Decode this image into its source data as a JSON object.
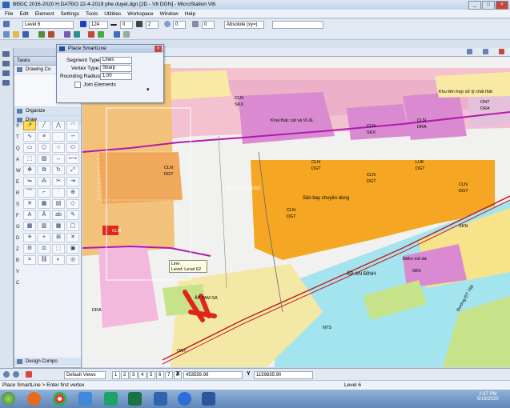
{
  "window": {
    "title": "BĐDC 2016-2020 H.DATĐO 22-4-2019 phe duyet.dgn [2D - V8 DGN] - MicroStation V8i"
  },
  "menu": [
    "File",
    "Edit",
    "Element",
    "Settings",
    "Tools",
    "Utilities",
    "Workspace",
    "Window",
    "Help"
  ],
  "attributes_toolbar": {
    "level": "Level 6",
    "color": "124",
    "weight": "2",
    "style": "0",
    "transparency": "0",
    "priority": "0",
    "class": "Absolute (xy=)"
  },
  "tasks_panel": {
    "title": "Tasks",
    "items": [
      "Drawing Co"
    ],
    "organize": "Organize",
    "draw": "Draw",
    "design_compose": "Design Compo",
    "letters": [
      "X",
      "T",
      "Q",
      "A",
      "W",
      "E",
      "R",
      "S",
      "F",
      "G",
      "D",
      "Z",
      "B",
      "V",
      "C"
    ]
  },
  "smartline_dialog": {
    "title": "Place SmartLine",
    "segment_type_label": "Segment Type:",
    "segment_type_value": "Lines",
    "vertex_type_label": "Vertex Type:",
    "vertex_type_value": "Sharp",
    "rounding_radius_label": "Rounding Radius:",
    "rounding_radius_value": "1.00",
    "join_elements_label": "Join Elements"
  },
  "tooltip": {
    "line1": "Line",
    "line2": "Level: Level 62"
  },
  "map_labels": {
    "airport": "Sân bay chuyên dùng",
    "quarry": "Khai thác cát và VLXL",
    "waste": "Khu liên hợp xử lý chất thải",
    "mining": "Điểm mỏ đá",
    "road": "Đường ĐT 768",
    "hamlet": "ẤP AN BÌNH",
    "hamlet2": "ẤP TAM SA",
    "watermark": "Batdongsan",
    "codes": [
      "CLN",
      "DGT",
      "SKX",
      "ONT",
      "DRA",
      "NTS",
      "SKK",
      "LUK",
      "SKN"
    ]
  },
  "view_controls": {
    "views_label": "Default Views",
    "view_numbers": [
      "1",
      "2",
      "3",
      "4",
      "5",
      "6",
      "7",
      "8"
    ],
    "x_label": "X",
    "x_value": "453559.99",
    "y_label": "Y",
    "y_value": "1159835.90"
  },
  "status": {
    "prompt": "Place SmartLine > Enter first vertex",
    "level": "Level 6"
  },
  "taskbar": {
    "time": "2:37 PM",
    "date": "9/16/2020"
  },
  "colors": {
    "orange": "#f5a623",
    "pink": "#f2b3c9",
    "magenta": "#d97fc6",
    "cyan": "#9fe3ef",
    "yellow": "#f7e89a",
    "red": "#e0261b"
  }
}
